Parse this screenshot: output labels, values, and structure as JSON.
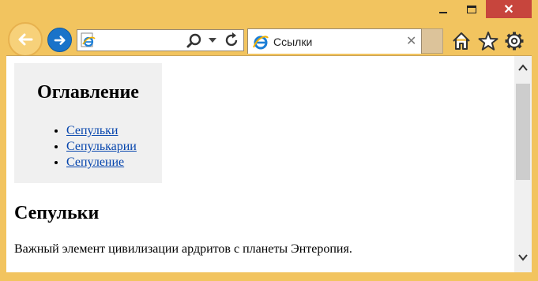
{
  "window": {
    "minimize_icon": "minimize-icon",
    "maximize_icon": "maximize-icon",
    "close_label": "✕"
  },
  "nav": {
    "back_icon": "back-arrow-icon",
    "forward_icon": "forward-arrow-icon",
    "address_value": "",
    "search_icon": "search-icon",
    "refresh_icon": "refresh-icon"
  },
  "tab": {
    "title": "Ссылки",
    "close_label": "✕"
  },
  "toolbar": {
    "home_icon": "home-icon",
    "favorites_icon": "star-icon",
    "settings_icon": "gear-icon"
  },
  "page": {
    "toc_title": "Оглавление",
    "toc_items": [
      {
        "label": "Сепульки"
      },
      {
        "label": "Сепулькарии"
      },
      {
        "label": "Сепуление"
      }
    ],
    "section_title": "Сепульки",
    "section_text": "Важный элемент цивилизации ардритов с планеты Энтеропия."
  },
  "colors": {
    "frame": "#f2c45f",
    "close_button": "#c7453d",
    "link": "#0645ad",
    "toc_background": "#f0f0f0"
  }
}
